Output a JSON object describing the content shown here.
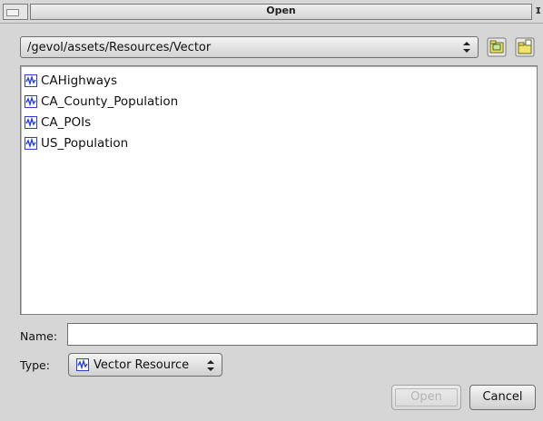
{
  "window": {
    "title": "Open"
  },
  "location": {
    "path": "/gevol/assets/Resources/Vector"
  },
  "toolbar": {
    "home_icon": "home-folder-icon",
    "new_folder_icon": "new-folder-icon"
  },
  "files": [
    {
      "name": "CAHighways",
      "icon": "vector-resource-icon"
    },
    {
      "name": "CA_County_Population",
      "icon": "vector-resource-icon"
    },
    {
      "name": "CA_POIs",
      "icon": "vector-resource-icon"
    },
    {
      "name": "US_Population",
      "icon": "vector-resource-icon"
    }
  ],
  "name_field": {
    "label": "Name:",
    "value": ""
  },
  "type_field": {
    "label": "Type:",
    "selected": "Vector Resource",
    "icon": "vector-resource-icon"
  },
  "buttons": {
    "open_label": "Open",
    "open_enabled": false,
    "cancel_label": "Cancel"
  },
  "colors": {
    "icon_blue": "#2a3fd6",
    "window_bg": "#d6d6d6"
  }
}
